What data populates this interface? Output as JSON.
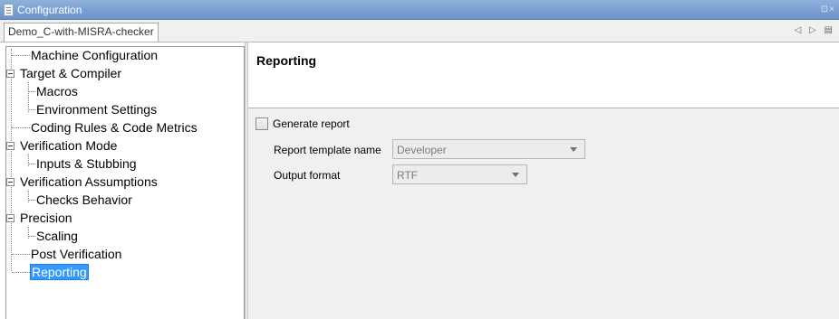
{
  "window": {
    "title": "Configuration",
    "controls": "⊡×"
  },
  "tabs": [
    {
      "label": "Demo_C-with-MISRA-checker"
    }
  ],
  "tab_nav": "◁ ▷ ▤",
  "tree": {
    "items": [
      {
        "label": "Machine Configuration",
        "level": 0,
        "expandable": false
      },
      {
        "label": "Target & Compiler",
        "level": 0,
        "expandable": true
      },
      {
        "label": "Macros",
        "level": 1,
        "expandable": false
      },
      {
        "label": "Environment Settings",
        "level": 1,
        "expandable": false
      },
      {
        "label": "Coding Rules & Code Metrics",
        "level": 0,
        "expandable": false
      },
      {
        "label": "Verification Mode",
        "level": 0,
        "expandable": true
      },
      {
        "label": "Inputs & Stubbing",
        "level": 1,
        "expandable": false
      },
      {
        "label": "Verification Assumptions",
        "level": 0,
        "expandable": true
      },
      {
        "label": "Checks Behavior",
        "level": 1,
        "expandable": false
      },
      {
        "label": "Precision",
        "level": 0,
        "expandable": true
      },
      {
        "label": "Scaling",
        "level": 1,
        "expandable": false
      },
      {
        "label": "Post Verification",
        "level": 0,
        "expandable": false
      },
      {
        "label": "Reporting",
        "level": 0,
        "expandable": false,
        "selected": true
      }
    ]
  },
  "panel": {
    "title": "Reporting",
    "generate_report": {
      "label": "Generate report",
      "checked": false
    },
    "report_template": {
      "label": "Report template name",
      "value": "Developer"
    },
    "output_format": {
      "label": "Output format",
      "value": "RTF"
    }
  },
  "colors": {
    "title_bar": "#7aa0d2",
    "selection": "#3399ff",
    "panel_bg": "#f0f0f0"
  }
}
